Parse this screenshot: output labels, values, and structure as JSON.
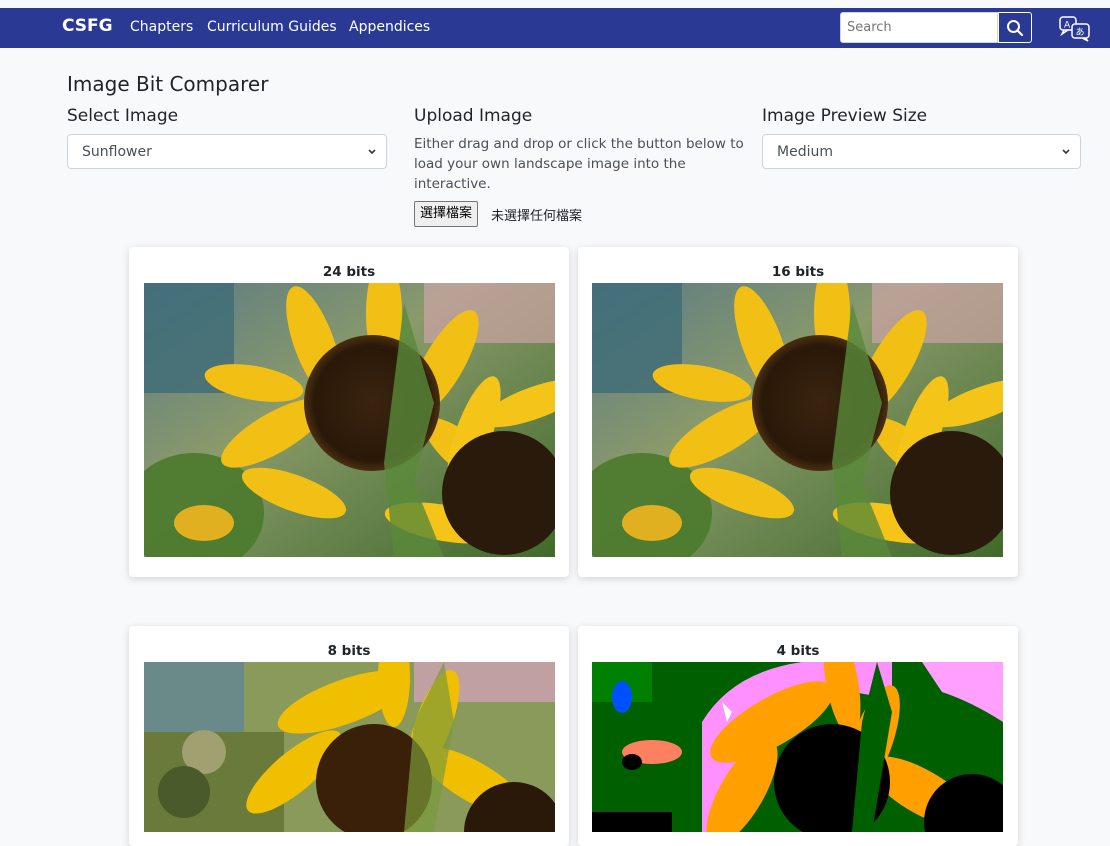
{
  "nav": {
    "brand": "CSFG",
    "links": [
      "Chapters",
      "Curriculum Guides",
      "Appendices"
    ],
    "search_placeholder": "Search",
    "icons": {
      "search": "magnifier-icon",
      "language": "translate-icon"
    },
    "bg_color": "#2a3a94"
  },
  "page": {
    "title": "Image Bit Comparer"
  },
  "select_image": {
    "label": "Select Image",
    "value": "Sunflower"
  },
  "upload": {
    "label": "Upload Image",
    "description": "Either drag and drop or click the button below to load your own landscape image into the interactive.",
    "button": "選擇檔案",
    "status": "未選擇任何檔案"
  },
  "preview_size": {
    "label": "Image Preview Size",
    "value": "Medium"
  },
  "cards": [
    {
      "title": "24 bits"
    },
    {
      "title": "16 bits"
    },
    {
      "title": "8 bits"
    },
    {
      "title": "4 bits"
    }
  ]
}
